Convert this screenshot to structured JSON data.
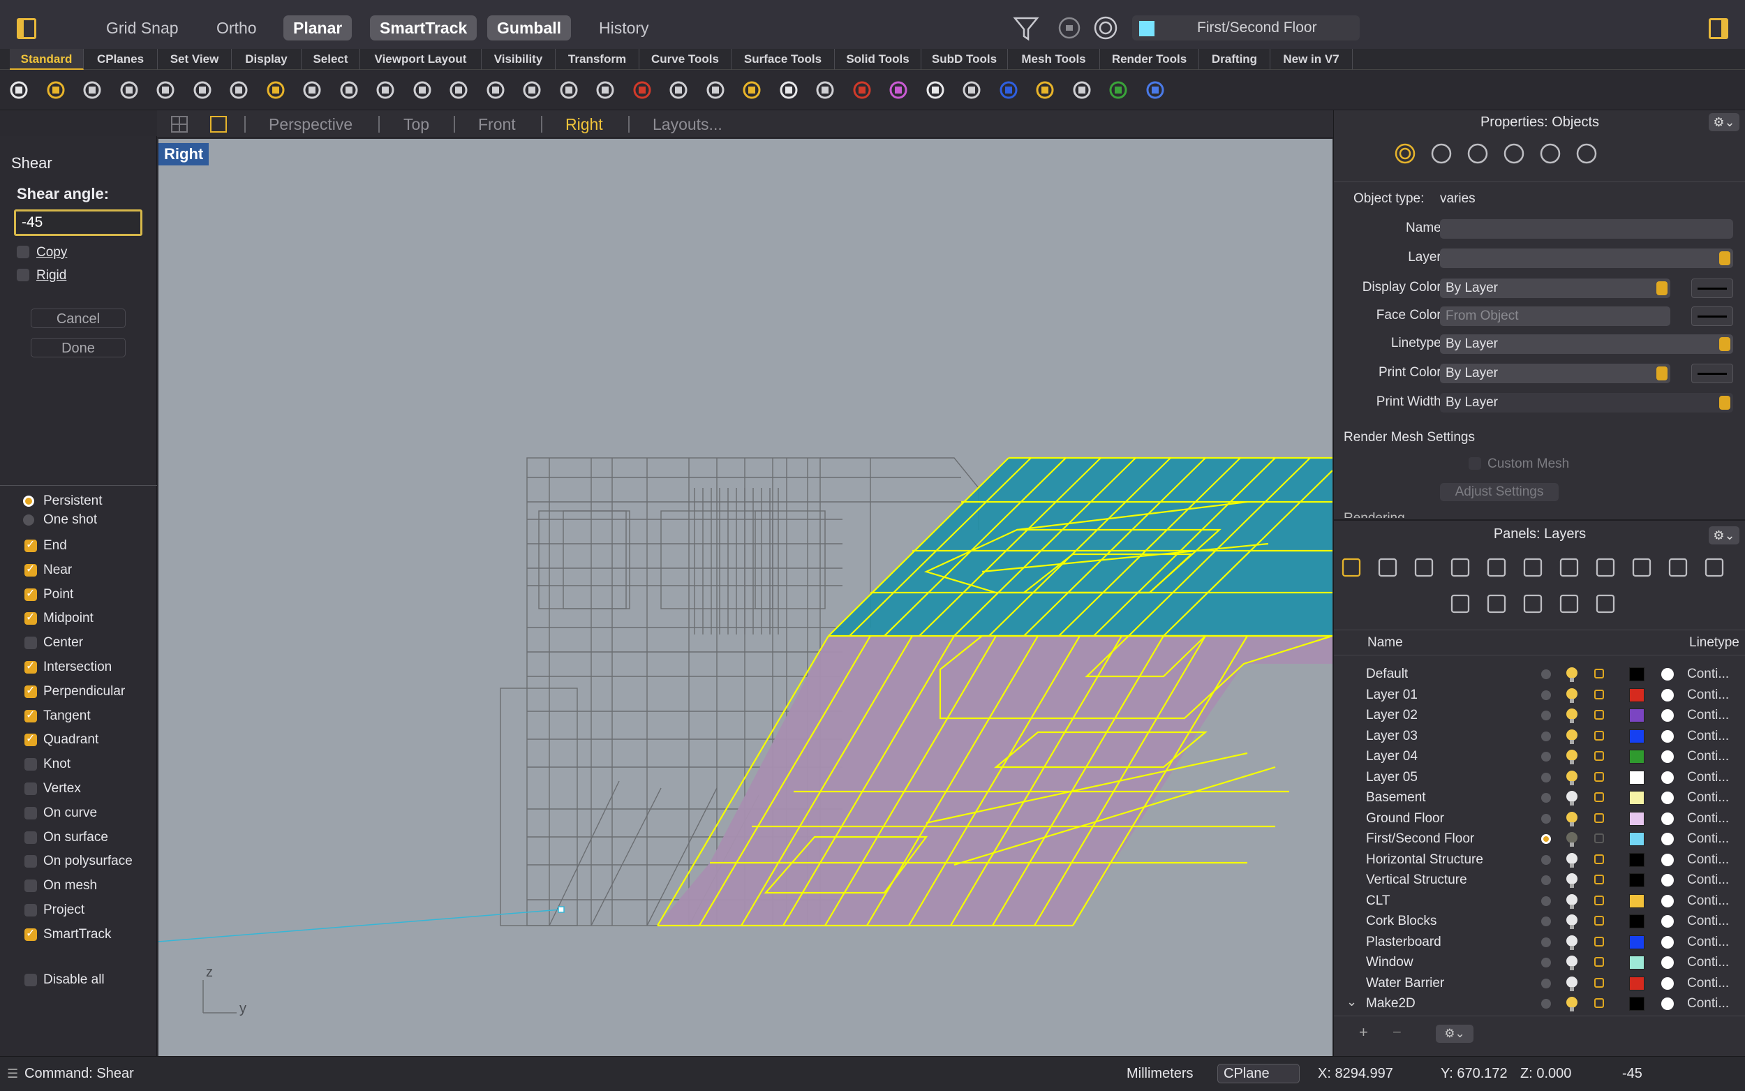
{
  "topbar": {
    "toggles": [
      {
        "label": "Grid Snap",
        "on": false
      },
      {
        "label": "Ortho",
        "on": false
      },
      {
        "label": "Planar",
        "on": true
      },
      {
        "label": "SmartTrack",
        "on": true
      },
      {
        "label": "Gumball",
        "on": true
      },
      {
        "label": "History",
        "on": false
      }
    ],
    "current_layer": "First/Second Floor",
    "icons": [
      "filter-icon",
      "snap-icon",
      "target-icon"
    ]
  },
  "tabs": [
    "Standard",
    "CPlanes",
    "Set View",
    "Display",
    "Select",
    "Viewport Layout",
    "Visibility",
    "Transform",
    "Curve Tools",
    "Surface Tools",
    "Solid Tools",
    "SubD Tools",
    "Mesh Tools",
    "Render Tools",
    "Drafting",
    "New in V7"
  ],
  "active_tab": "Standard",
  "toolbar_icons": [
    "new-file-icon",
    "open-file-icon",
    "save-icon",
    "print-icon",
    "import-icon",
    "cut-icon",
    "copy-icon",
    "paste-icon",
    "undo-icon",
    "pan-icon",
    "rotate-view-icon",
    "zoom-icon",
    "zoom-window-icon",
    "zoom-extents-icon",
    "zoom-selected-icon",
    "rotate-icon",
    "viewport-layout-icon",
    "car-icon",
    "grid-icon",
    "circle-icon",
    "points-icon",
    "light-icon",
    "lock-icon",
    "layer-icon",
    "color-wheel-icon",
    "sphere-icon",
    "render-sphere-icon",
    "blue-sphere-icon",
    "pen-icon",
    "align-icon",
    "globe-icon",
    "help-icon"
  ],
  "viewport_tabs": [
    "Perspective",
    "Top",
    "Front",
    "Right",
    "Layouts..."
  ],
  "active_viewport": "Right",
  "viewport_label": "Right",
  "axis": {
    "z": "z",
    "y": "y"
  },
  "command": {
    "title": "Shear",
    "prompt": "Shear angle:",
    "value": "-45",
    "options": [
      {
        "label": "Copy",
        "checked": false
      },
      {
        "label": "Rigid",
        "checked": false
      }
    ],
    "cancel": "Cancel",
    "done": "Done"
  },
  "osnap": {
    "mode": [
      {
        "label": "Persistent",
        "selected": true
      },
      {
        "label": "One shot",
        "selected": false
      }
    ],
    "items": [
      {
        "label": "End",
        "checked": true
      },
      {
        "label": "Near",
        "checked": true
      },
      {
        "label": "Point",
        "checked": true
      },
      {
        "label": "Midpoint",
        "checked": true
      },
      {
        "label": "Center",
        "checked": false
      },
      {
        "label": "Intersection",
        "checked": true
      },
      {
        "label": "Perpendicular",
        "checked": true
      },
      {
        "label": "Tangent",
        "checked": true
      },
      {
        "label": "Quadrant",
        "checked": true
      },
      {
        "label": "Knot",
        "checked": false
      },
      {
        "label": "Vertex",
        "checked": false
      },
      {
        "label": "On curve",
        "checked": false
      },
      {
        "label": "On surface",
        "checked": false
      },
      {
        "label": "On polysurface",
        "checked": false
      },
      {
        "label": "On mesh",
        "checked": false
      },
      {
        "label": "Project",
        "checked": false
      },
      {
        "label": "SmartTrack",
        "checked": true
      }
    ],
    "disable_all": "Disable all"
  },
  "properties": {
    "title": "Properties: Objects",
    "object_type_label": "Object type:",
    "object_type_value": "varies",
    "name_label": "Name:",
    "layer_label": "Layer:",
    "display_color_label": "Display Color:",
    "display_color_value": "By Layer",
    "face_color_label": "Face Color:",
    "face_color_value": "From Object",
    "linetype_label": "Linetype:",
    "linetype_value": "By Layer",
    "print_color_label": "Print Color:",
    "print_color_value": "By Layer",
    "print_width_label": "Print Width:",
    "print_width_value": "By Layer",
    "render_mesh_title": "Render Mesh Settings",
    "custom_mesh": "Custom Mesh",
    "adjust_settings": "Adjust Settings",
    "rendering": "Rendering"
  },
  "layers_panel": {
    "title": "Panels: Layers",
    "col_name": "Name",
    "col_linetype": "Linetype",
    "rows": [
      {
        "name": "Default",
        "color": "#000000",
        "current": false,
        "on": true,
        "linetype": "Conti..."
      },
      {
        "name": "Layer 01",
        "color": "#d62a1e",
        "current": false,
        "on": true,
        "linetype": "Conti..."
      },
      {
        "name": "Layer 02",
        "color": "#7b45c2",
        "current": false,
        "on": true,
        "linetype": "Conti..."
      },
      {
        "name": "Layer 03",
        "color": "#1540f2",
        "current": false,
        "on": true,
        "linetype": "Conti..."
      },
      {
        "name": "Layer 04",
        "color": "#2f9a2e",
        "current": false,
        "on": true,
        "linetype": "Conti..."
      },
      {
        "name": "Layer 05",
        "color": "#ffffff",
        "current": false,
        "on": true,
        "linetype": "Conti..."
      },
      {
        "name": "Basement",
        "color": "#f7f4a6",
        "current": false,
        "on": false,
        "linetype": "Conti..."
      },
      {
        "name": "Ground Floor",
        "color": "#e7c7ef",
        "current": false,
        "on": true,
        "linetype": "Conti..."
      },
      {
        "name": "First/Second Floor",
        "color": "#74d6f4",
        "current": true,
        "on": true,
        "linetype": "Conti..."
      },
      {
        "name": "Horizontal Structure",
        "color": "#000000",
        "current": false,
        "on": false,
        "linetype": "Conti..."
      },
      {
        "name": "Vertical Structure",
        "color": "#000000",
        "current": false,
        "on": false,
        "linetype": "Conti..."
      },
      {
        "name": "CLT",
        "color": "#f2c13a",
        "current": false,
        "on": false,
        "linetype": "Conti..."
      },
      {
        "name": "Cork Blocks",
        "color": "#000000",
        "current": false,
        "on": false,
        "linetype": "Conti..."
      },
      {
        "name": "Plasterboard",
        "color": "#1540f2",
        "current": false,
        "on": false,
        "linetype": "Conti..."
      },
      {
        "name": "Window",
        "color": "#9ee9d7",
        "current": false,
        "on": false,
        "linetype": "Conti..."
      },
      {
        "name": "Water Barrier",
        "color": "#d62a1e",
        "current": false,
        "on": false,
        "linetype": "Conti..."
      },
      {
        "name": "Make2D",
        "color": "#000000",
        "current": false,
        "on": true,
        "linetype": "Conti..."
      }
    ],
    "add": "+",
    "remove": "−"
  },
  "status": {
    "command": "Command: Shear",
    "units": "Millimeters",
    "cplane": "CPlane",
    "x": "X: 8294.997",
    "y": "Y: 670.172",
    "z": "Z: 0.000",
    "value": "-45"
  }
}
